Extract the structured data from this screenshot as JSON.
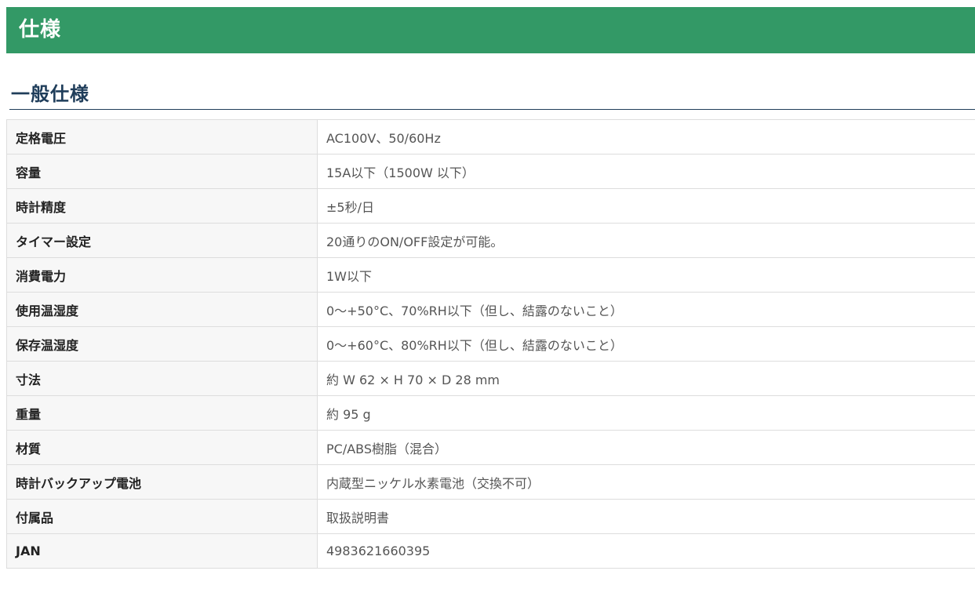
{
  "section_title": "仕様",
  "subheading": "一般仕様",
  "specs": [
    {
      "label": "定格電圧",
      "value": "AC100V、50/60Hz"
    },
    {
      "label": "容量",
      "value": "15A以下（1500W 以下）"
    },
    {
      "label": "時計精度",
      "value": "±5秒/日"
    },
    {
      "label": "タイマー設定",
      "value": "20通りのON/OFF設定が可能。"
    },
    {
      "label": "消費電力",
      "value": "1W以下"
    },
    {
      "label": "使用温湿度",
      "value": "0～+50°C、70%RH以下（但し、結露のないこと）"
    },
    {
      "label": "保存温湿度",
      "value": "0～+60°C、80%RH以下（但し、結露のないこと）"
    },
    {
      "label": "寸法",
      "value": "約 W 62 × H 70 × D 28 mm"
    },
    {
      "label": "重量",
      "value": "約 95 g"
    },
    {
      "label": "材質",
      "value": "PC/ABS樹脂（混合）"
    },
    {
      "label": "時計バックアップ電池",
      "value": "内蔵型ニッケル水素電池（交換不可）"
    },
    {
      "label": "付属品",
      "value": "取扱説明書"
    },
    {
      "label": "JAN",
      "value": "4983621660395"
    }
  ],
  "colors": {
    "header_bg": "#339966",
    "heading_text": "#1f3d5a",
    "label_bg": "#f7f7f7",
    "border": "#dddddd"
  }
}
